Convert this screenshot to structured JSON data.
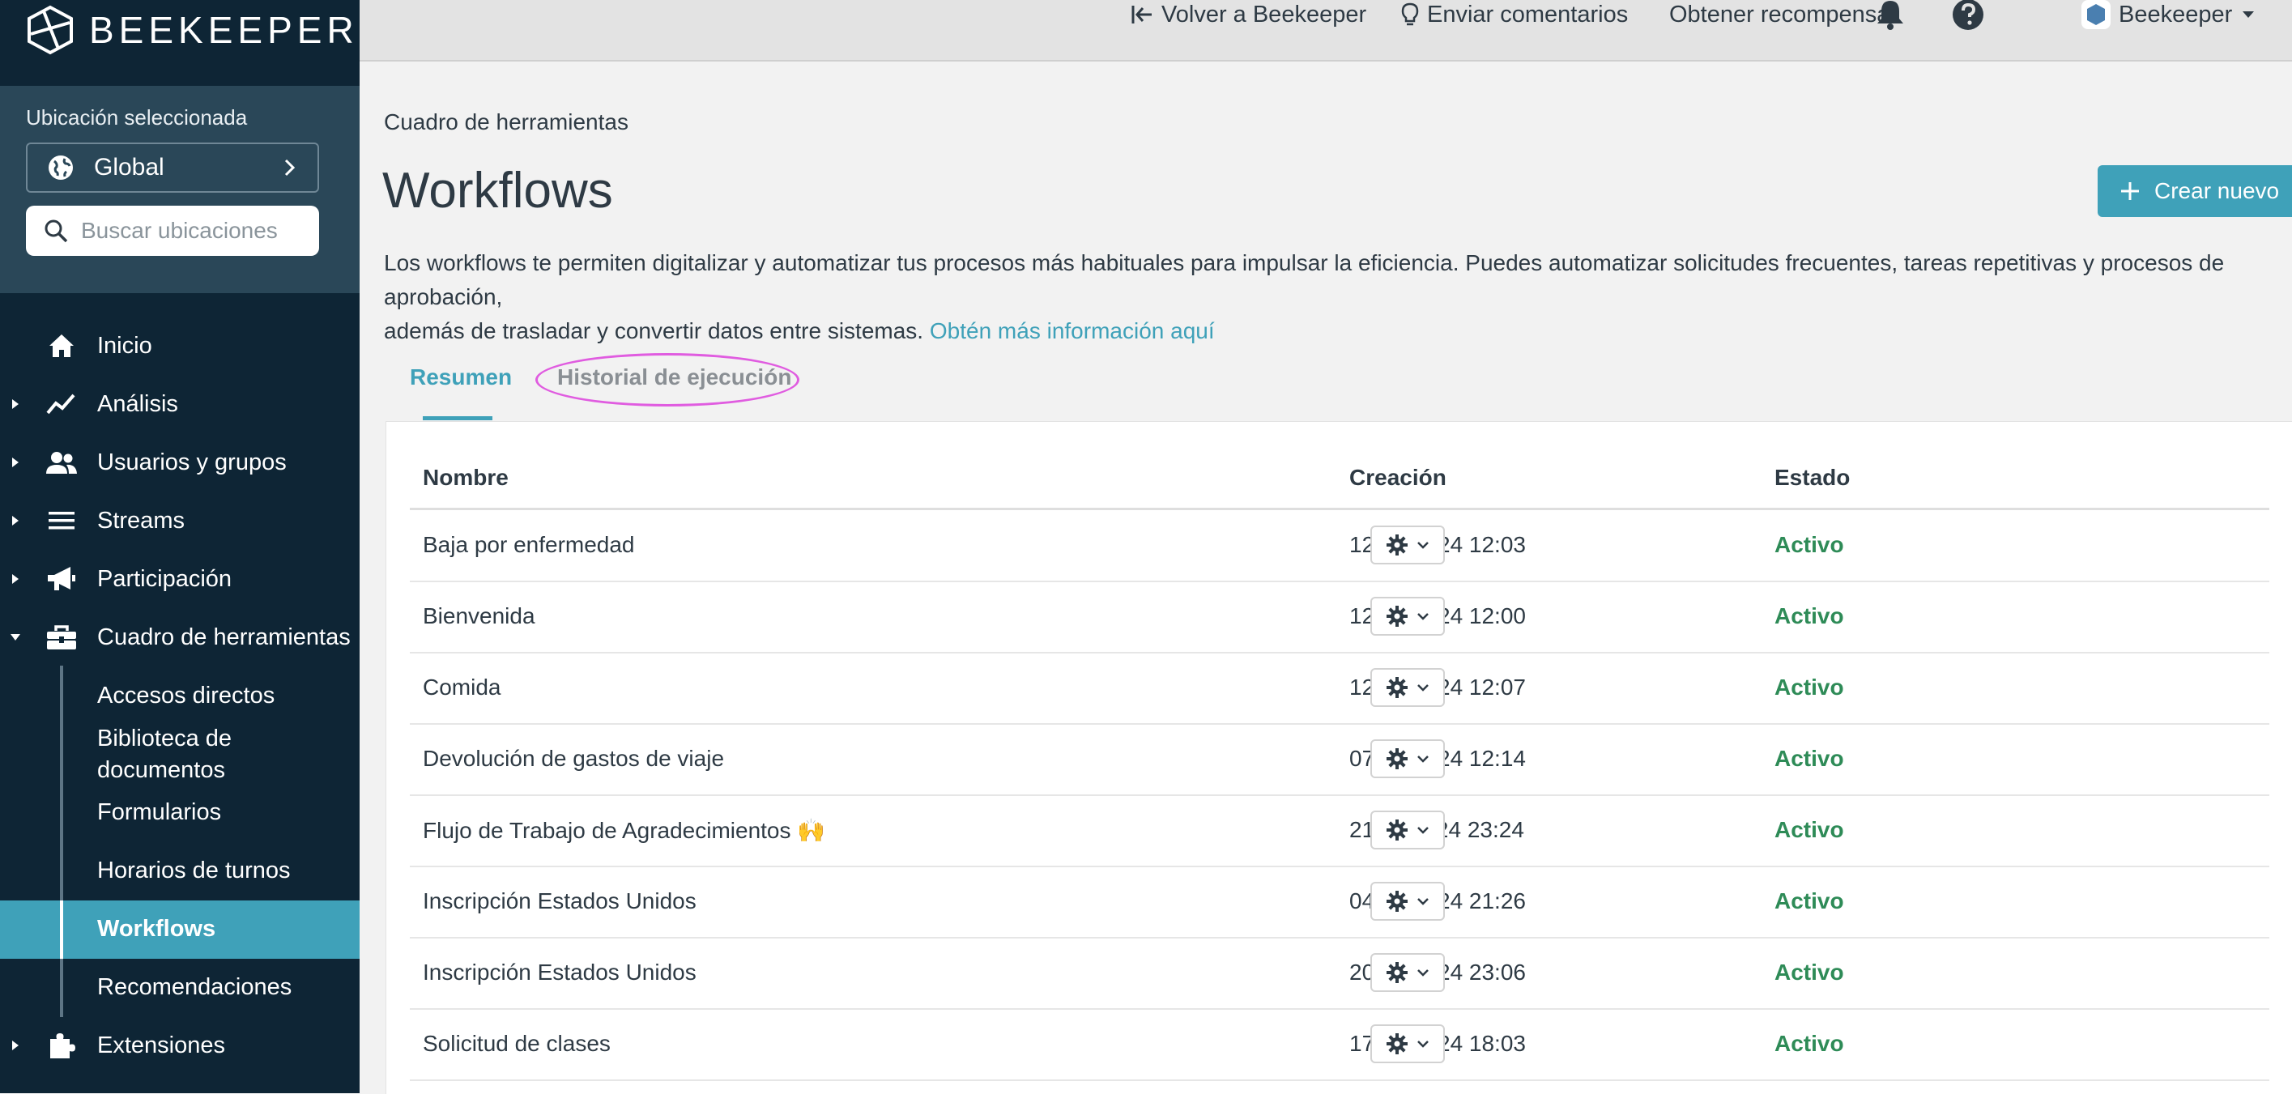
{
  "sidebar": {
    "logo_text": "BEEKEEPER",
    "location_label": "Ubicación seleccionada",
    "location_value": "Global",
    "search_placeholder": "Buscar ubicaciones",
    "nav": [
      {
        "label": "Inicio",
        "icon": "home-icon"
      },
      {
        "label": "Análisis",
        "icon": "chart-line-icon"
      },
      {
        "label": "Usuarios y grupos",
        "icon": "users-icon"
      },
      {
        "label": "Streams",
        "icon": "list-icon"
      },
      {
        "label": "Participación",
        "icon": "megaphone-icon"
      },
      {
        "label": "Cuadro de herramientas",
        "icon": "toolbox-icon"
      },
      {
        "label": "Extensiones",
        "icon": "puzzle-icon"
      }
    ],
    "subnav": [
      "Accesos directos",
      "Biblioteca de",
      "documentos",
      "Formularios",
      "Horarios de turnos",
      "Workflows",
      "Recomendaciones"
    ],
    "active_subnav": "Workflows"
  },
  "topbar": {
    "back": "Volver a Beekeeper",
    "feedback": "Enviar comentarios",
    "reward": "Obtener recompensa",
    "user": "Beekeeper"
  },
  "main": {
    "breadcrumb": "Cuadro de herramientas",
    "title": "Workflows",
    "create_button": "Crear nuevo",
    "description_line1": "Los workflows te permiten digitalizar y automatizar tus procesos más habituales para impulsar la eficiencia. Puedes automatizar solicitudes frecuentes, tareas repetitivas y procesos de aprobación,",
    "description_line2": "además de trasladar y convertir datos entre sistemas.",
    "description_link": "Obtén más información aquí",
    "tabs": [
      "Resumen",
      "Historial de ejecución"
    ],
    "table": {
      "headers": [
        "Nombre",
        "Creación",
        "Estado"
      ],
      "rows": [
        {
          "name": "Baja por enfermedad",
          "created": "12.03.2024 12:03",
          "status": "Activo"
        },
        {
          "name": "Bienvenida",
          "created": "12.03.2024 12:00",
          "status": "Activo"
        },
        {
          "name": "Comida",
          "created": "12.03.2024 12:07",
          "status": "Activo"
        },
        {
          "name": "Devolución de gastos de viaje",
          "created": "07.08.2024 12:14",
          "status": "Activo"
        },
        {
          "name": "Flujo de Trabajo de Agradecimientos 🙌",
          "created": "21.11.2024 23:24",
          "status": "Activo"
        },
        {
          "name": "Inscripción Estados Unidos",
          "created": "04.06.2024 21:26",
          "status": "Activo"
        },
        {
          "name": "Inscripción Estados Unidos",
          "created": "20.12.2024 23:06",
          "status": "Activo"
        },
        {
          "name": "Solicitud de clases",
          "created": "17.12.2024 18:03",
          "status": "Activo"
        }
      ]
    }
  },
  "colors": {
    "sidebar": "#0e2535",
    "accent": "#3fa1b9",
    "status_active": "#2e8b57",
    "highlight": "#e05ce0"
  }
}
